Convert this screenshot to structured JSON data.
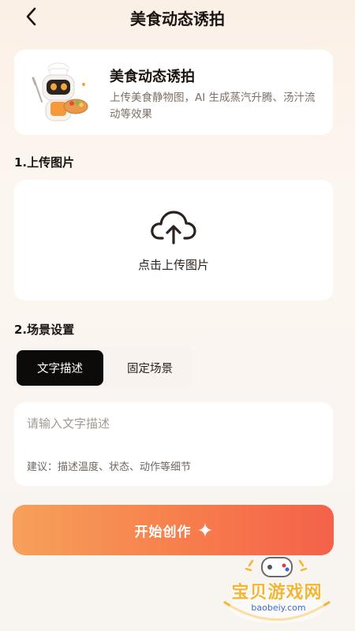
{
  "header": {
    "title": "美食动态诱拍",
    "back_icon": "chevron-left-icon"
  },
  "intro": {
    "title": "美食动态诱拍",
    "description": "上传美食静物图，AI 生成蒸汽升腾、汤汁流动等效果",
    "mascot": "robot-chef-mascot"
  },
  "upload": {
    "section_label": "1.上传图片",
    "button_label": "点击上传图片",
    "icon": "cloud-upload-icon"
  },
  "scene": {
    "section_label": "2.场景设置",
    "tabs": [
      {
        "label": "文字描述",
        "active": true
      },
      {
        "label": "固定场景",
        "active": false
      }
    ],
    "input_placeholder": "请输入文字描述",
    "input_value": "",
    "hint": "建议：描述温度、状态、动作等细节"
  },
  "action": {
    "start_label": "开始创作",
    "icon": "sparkle-icon"
  },
  "watermark": {
    "name": "宝贝游戏网",
    "url": "baobeiy.com"
  },
  "colors": {
    "accent_start": "#f6a15a",
    "accent_end": "#f4614a",
    "tab_active_bg": "#0d0b0a",
    "watermark_text": "#f4b534"
  }
}
